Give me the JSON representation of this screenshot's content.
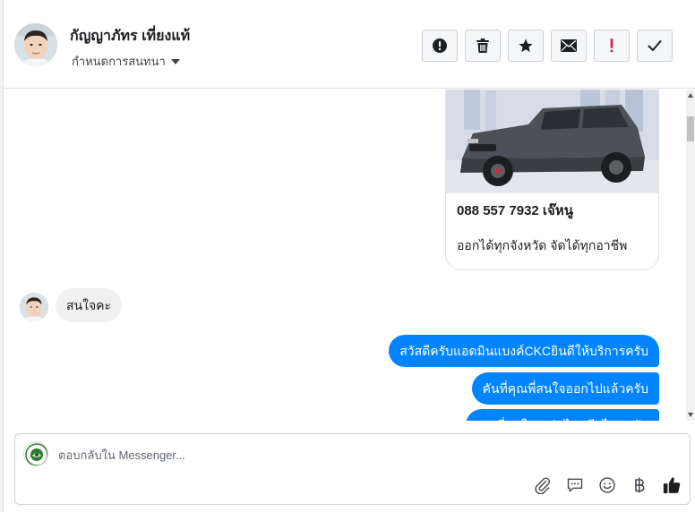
{
  "header": {
    "contact_name": "กัญญาภัทร เที่ยงแท้",
    "assign_label": "กำหนดการสนทนา",
    "actions": [
      {
        "name": "mark-spam-button",
        "icon": "exclamation-circle-icon"
      },
      {
        "name": "delete-button",
        "icon": "trash-icon"
      },
      {
        "name": "star-button",
        "icon": "star-icon"
      },
      {
        "name": "mark-unread-button",
        "icon": "envelope-icon"
      },
      {
        "name": "follow-up-button",
        "icon": "exclamation-icon"
      },
      {
        "name": "mark-done-button",
        "icon": "check-icon"
      }
    ]
  },
  "messages": {
    "card": {
      "title": "088 557 7932 เจ๊หนู",
      "subtitle": "ออกได้ทุกจังหวัด จัดได้ทุกอาชีพ"
    },
    "incoming": [
      {
        "text": "สนใจคะ"
      }
    ],
    "outgoing": [
      {
        "text": "สวัสดีครับแอดมินแบงค์CKCยินดีให้บริการครับ"
      },
      {
        "text": "คันที่คุณพี่สนใจออกไปแล้วครับ"
      },
      {
        "text": "คุณพี่สนใจรถรุ่นไหนอีกไหมครับ"
      }
    ]
  },
  "composer": {
    "placeholder": "ตอบกลับใน Messenger...",
    "tools": [
      "paperclip-icon",
      "saved-reply-icon",
      "emoji-icon",
      "baht-icon",
      "thumbs-up-icon"
    ]
  },
  "colors": {
    "outgoing_bubble": "#0084ff",
    "incoming_bubble": "#f0f0f0",
    "follow_up_red": "#e0245e"
  }
}
